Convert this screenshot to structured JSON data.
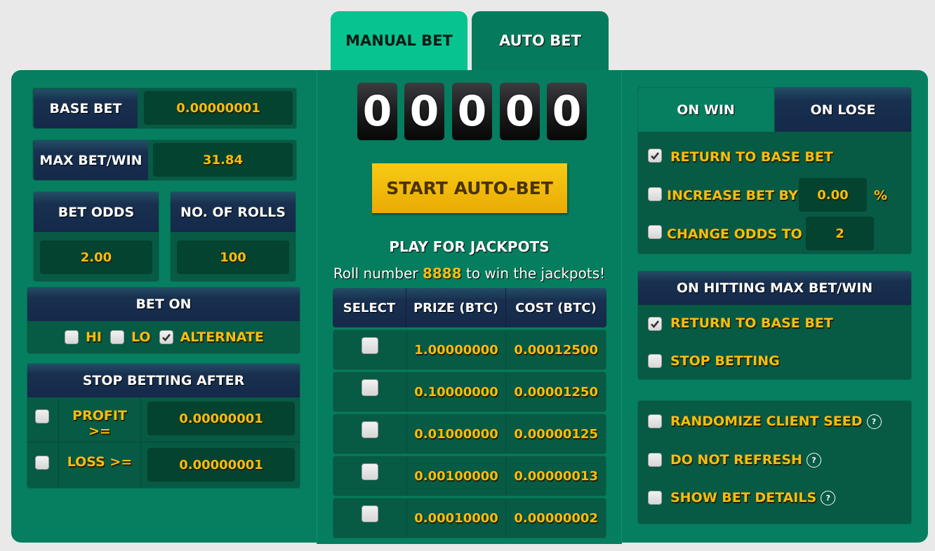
{
  "tabs": [
    {
      "label": "MANUAL BET",
      "active": false
    },
    {
      "label": "AUTO BET",
      "active": true
    }
  ],
  "left": {
    "base_bet": {
      "label": "BASE BET",
      "value": "0.00000001"
    },
    "max_bet_win": {
      "label": "MAX BET/WIN",
      "value": "31.84"
    },
    "bet_odds": {
      "label": "BET ODDS",
      "value": "2.00"
    },
    "num_rolls": {
      "label": "NO. OF ROLLS",
      "value": "100"
    },
    "bet_on": {
      "title": "BET ON",
      "options": [
        {
          "label": "HI",
          "checked": false
        },
        {
          "label": "LO",
          "checked": false
        },
        {
          "label": "ALTERNATE",
          "checked": true
        }
      ]
    },
    "stop_after": {
      "title": "STOP BETTING AFTER",
      "rows": [
        {
          "label": "PROFIT >=",
          "value": "0.00000001",
          "checked": false
        },
        {
          "label": "LOSS >=",
          "value": "0.00000001",
          "checked": false
        }
      ]
    }
  },
  "center": {
    "counter_digits": [
      "0",
      "0",
      "0",
      "0",
      "0"
    ],
    "start_button": "START AUTO-BET",
    "jackpot_title": "PLAY FOR JACKPOTS",
    "jackpot_text_before": "Roll number ",
    "jackpot_number": "8888",
    "jackpot_text_after": " to win the jackpots!",
    "table": {
      "headers": [
        "SELECT",
        "PRIZE (BTC)",
        "COST (BTC)"
      ],
      "rows": [
        {
          "checked": false,
          "prize": "1.00000000",
          "cost": "0.00012500"
        },
        {
          "checked": false,
          "prize": "0.10000000",
          "cost": "0.00001250"
        },
        {
          "checked": false,
          "prize": "0.01000000",
          "cost": "0.00000125"
        },
        {
          "checked": false,
          "prize": "0.00100000",
          "cost": "0.00000013"
        },
        {
          "checked": false,
          "prize": "0.00010000",
          "cost": "0.00000002"
        }
      ]
    }
  },
  "right": {
    "win_lose_tabs": [
      {
        "label": "ON WIN",
        "active": true
      },
      {
        "label": "ON LOSE",
        "active": false
      }
    ],
    "on_win": {
      "return_base": {
        "label": "RETURN TO BASE BET",
        "checked": true
      },
      "increase_by": {
        "label": "INCREASE BET BY",
        "value": "0.00",
        "unit": "%",
        "checked": false
      },
      "change_odds": {
        "label": "CHANGE ODDS TO",
        "value": "2",
        "checked": false
      }
    },
    "max_hit": {
      "title": "ON HITTING MAX BET/WIN",
      "options": [
        {
          "label": "RETURN TO BASE BET",
          "checked": true
        },
        {
          "label": "STOP BETTING",
          "checked": false
        }
      ]
    },
    "misc": [
      {
        "label": "RANDOMIZE CLIENT SEED",
        "checked": false,
        "help": "?"
      },
      {
        "label": "DO NOT REFRESH",
        "checked": false,
        "help": "?"
      },
      {
        "label": "SHOW BET DETAILS",
        "checked": false,
        "help": "?"
      }
    ]
  }
}
